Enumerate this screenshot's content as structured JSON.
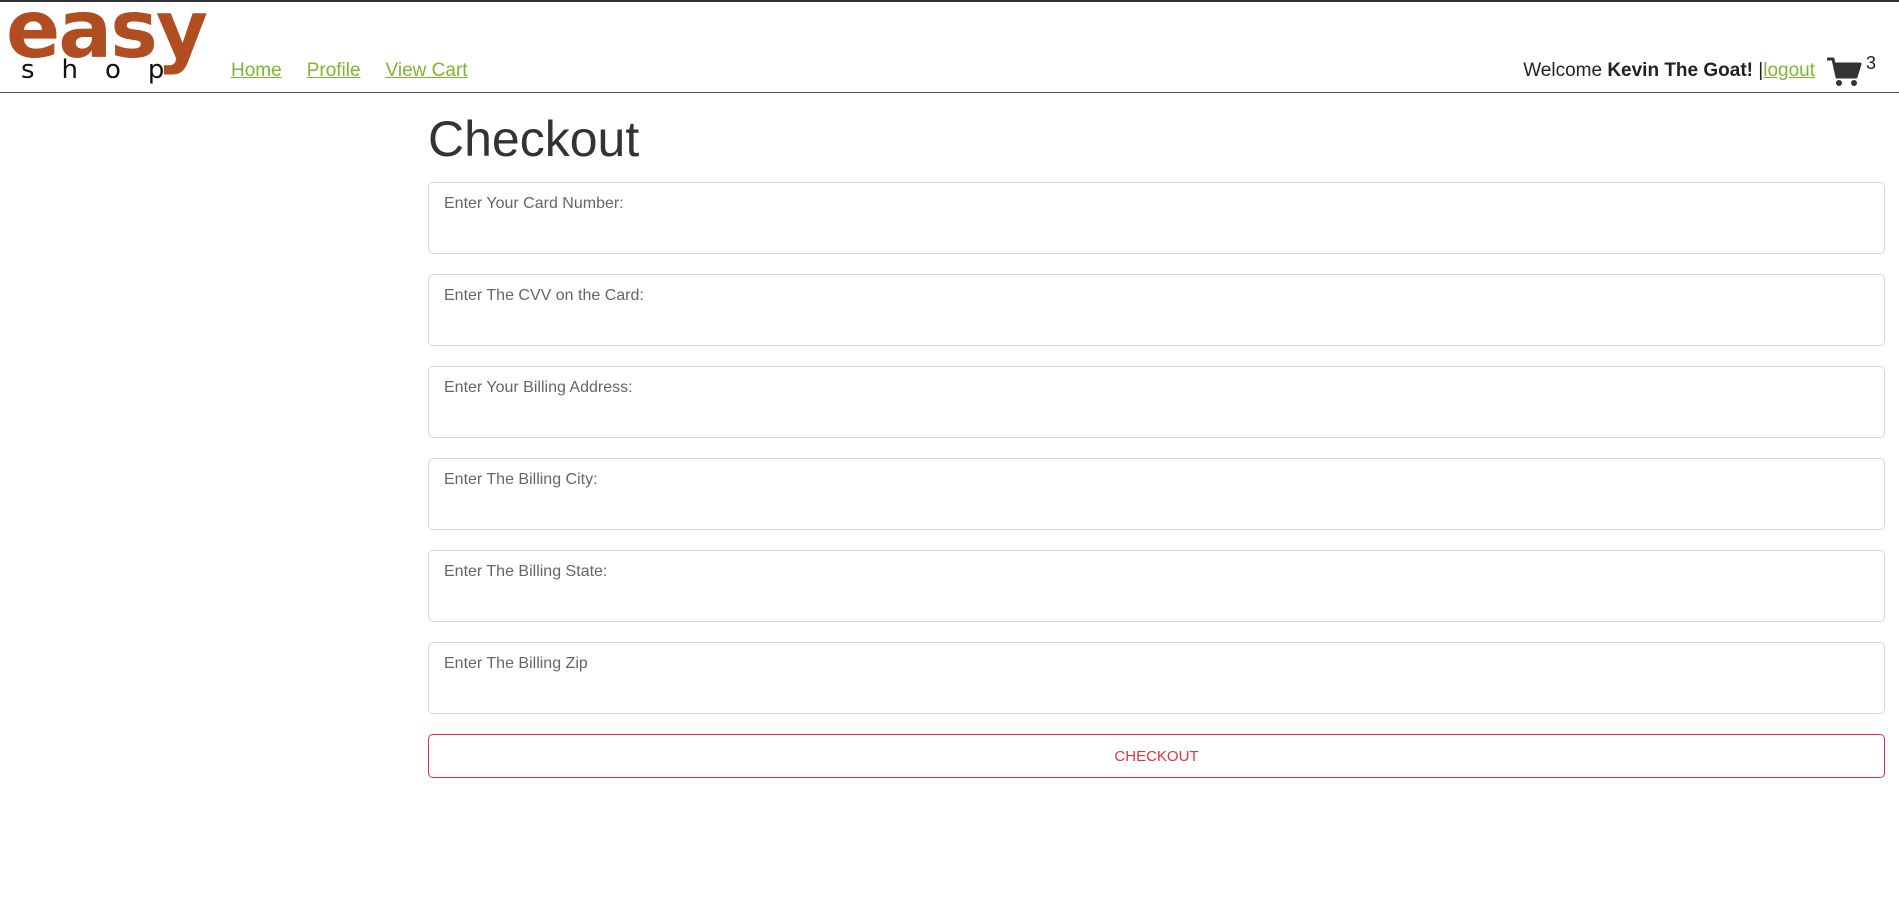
{
  "logo": {
    "top": "easy",
    "bottom": "shop"
  },
  "nav": {
    "home": "Home",
    "profile": "Profile",
    "view_cart": "View Cart"
  },
  "user": {
    "welcome": "Welcome",
    "name": "Kevin The Goat!",
    "separator": "|",
    "logout": "logout"
  },
  "cart": {
    "icon": "shopping-cart-icon",
    "count": "3"
  },
  "page": {
    "title": "Checkout"
  },
  "form": {
    "card_number_label": "Enter Your Card Number:",
    "cvv_label": "Enter The CVV on the Card:",
    "billing_address_label": "Enter Your Billing Address:",
    "billing_city_label": "Enter The Billing City:",
    "billing_state_label": "Enter The Billing State:",
    "billing_zip_label": "Enter The Billing Zip",
    "checkout_label": "CHECKOUT"
  },
  "colors": {
    "brand": "#b04e22",
    "link": "#7cb82f",
    "danger": "#e0343c"
  }
}
